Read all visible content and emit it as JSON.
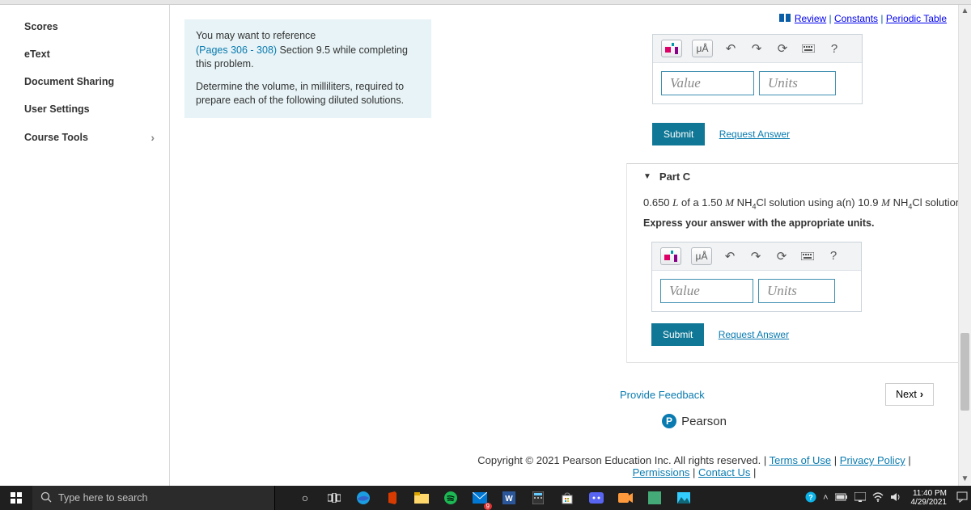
{
  "toplinks": {
    "review": "Review",
    "constants": "Constants",
    "periodic": "Periodic Table"
  },
  "sidebar": {
    "items": [
      {
        "label": "Scores"
      },
      {
        "label": "eText"
      },
      {
        "label": "Document Sharing"
      },
      {
        "label": "User Settings"
      },
      {
        "label": "Course Tools"
      }
    ]
  },
  "hint": {
    "line1": "You may want to reference",
    "pages_link": "(Pages 306 - 308)",
    "line1_cont": " Section 9.5 while completing this problem.",
    "line2": "Determine the volume, in milliliters, required to prepare each of the following diluted solutions."
  },
  "answer": {
    "value_placeholder": "Value",
    "units_placeholder": "Units",
    "mu": "μÅ",
    "help": "?"
  },
  "actions": {
    "submit": "Submit",
    "request": "Request Answer"
  },
  "partC": {
    "title": "Part C",
    "q_pre": "0.650 ",
    "q_L": "L",
    "q_mid1": " of a 1.50 ",
    "q_M1": "M",
    "q_nh4cl_1a": " NH",
    "q_nh4cl_1b": "Cl",
    "q_mid2": " solution using a(n) 10.9 ",
    "q_M2": "M",
    "q_nh4cl_2a": " NH",
    "q_nh4cl_2b": "Cl",
    "q_end": " solution",
    "sub4": "4",
    "instr": "Express your answer with the appropriate units."
  },
  "bottom": {
    "feedback": "Provide Feedback",
    "next": "Next",
    "pearson": "Pearson"
  },
  "copyright": {
    "text": "Copyright © 2021 Pearson Education Inc. All rights reserved.",
    "terms": "Terms of Use",
    "privacy": "Privacy Policy",
    "perm": "Permissions",
    "contact": "Contact Us"
  },
  "taskbar": {
    "search_placeholder": "Type here to search",
    "time": "11:40 PM",
    "date": "4/29/2021"
  }
}
